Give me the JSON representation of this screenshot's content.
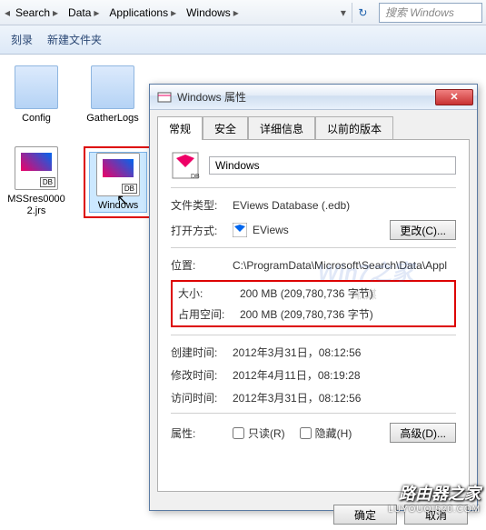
{
  "breadcrumb": {
    "segments": [
      "Search",
      "Data",
      "Applications",
      "Windows"
    ],
    "search_placeholder": "搜索 Windows"
  },
  "toolbar": {
    "burn": "刻录",
    "new_folder": "新建文件夹"
  },
  "files": [
    {
      "name": "Config",
      "type": "folder"
    },
    {
      "name": "GatherLogs",
      "type": "folder"
    },
    {
      "name": "MSSres0000\n2.jrs",
      "type": "doc"
    },
    {
      "name": "Windows",
      "type": "edb",
      "selected": true
    }
  ],
  "props": {
    "title": "Windows 属性",
    "tabs": [
      "常规",
      "安全",
      "详细信息",
      "以前的版本"
    ],
    "name_value": "Windows",
    "rows": {
      "filetype_label": "文件类型:",
      "filetype_value": "EViews Database (.edb)",
      "openwith_label": "打开方式:",
      "openwith_value": "EViews",
      "change_btn": "更改(C)...",
      "location_label": "位置:",
      "location_value": "C:\\ProgramData\\Microsoft\\Search\\Data\\Appl",
      "size_label": "大小:",
      "size_value": "200 MB (209,780,736 字节)",
      "sizeondisk_label": "占用空间:",
      "sizeondisk_value": "200 MB (209,780,736 字节)",
      "created_label": "创建时间:",
      "created_value": "2012年3月31日，08:12:56",
      "modified_label": "修改时间:",
      "modified_value": "2012年4月11日，08:19:28",
      "accessed_label": "访问时间:",
      "accessed_value": "2012年3月31日，08:12:56",
      "attrs_label": "属性:",
      "readonly_label": "只读(R)",
      "hidden_label": "隐藏(H)",
      "advanced_btn": "高级(D)..."
    },
    "ok_btn": "确定",
    "cancel_btn": "取消"
  },
  "watermarks": {
    "w1_main": "Win7之家",
    "w1_sub": "软媒",
    "w2_main": "路由器之家",
    "w2_sub": "LUYOUQI520.COM"
  }
}
